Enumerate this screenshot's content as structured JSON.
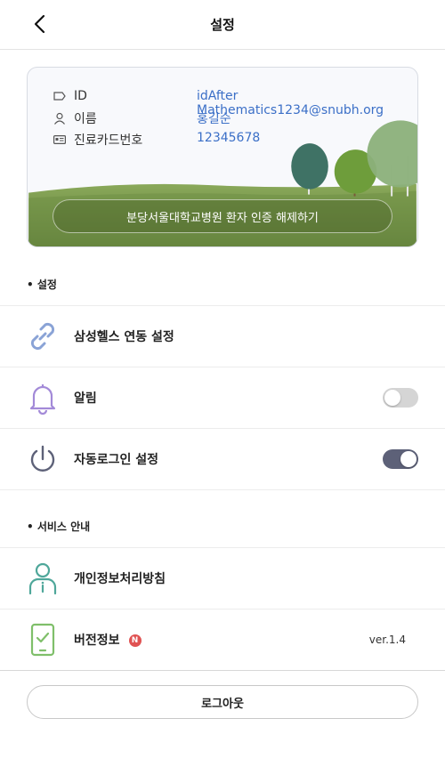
{
  "header": {
    "title": "설정"
  },
  "profile": {
    "id_label": "ID",
    "id_value": "idAfter Mathematics1234@snubh.org",
    "name_label": "이름",
    "name_value": "홍길순",
    "card_label": "진료카드번호",
    "card_value": "12345678",
    "cert_button_label": "분당서울대학교병원 환자 인증 해제하기"
  },
  "settings": {
    "section_title": "• 설정",
    "items": [
      {
        "label": "삼성헬스 연동 설정"
      },
      {
        "label": "알림",
        "toggle": false
      },
      {
        "label": "자동로그인 설정",
        "toggle": true
      }
    ]
  },
  "service": {
    "section_title": "• 서비스 안내",
    "items": [
      {
        "label": "개인정보처리방침"
      },
      {
        "label": "버전정보",
        "badge": "N",
        "version": "ver.1.4"
      }
    ]
  },
  "logout": {
    "label": "로그아웃"
  },
  "colors": {
    "link_blue": "#3b6fc7",
    "toggle_on": "#5d6178",
    "badge_red": "#e05252"
  }
}
